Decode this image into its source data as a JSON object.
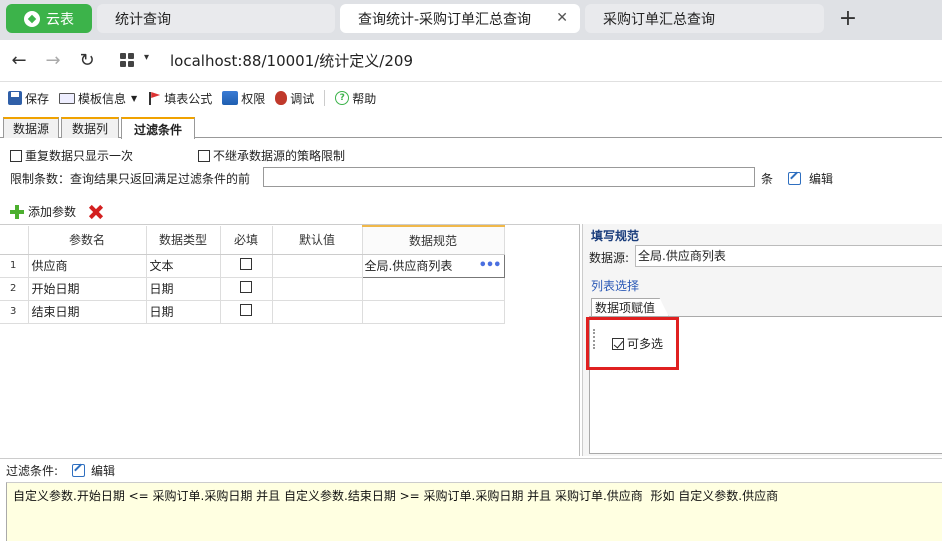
{
  "browser": {
    "brand": "云表",
    "tabs": [
      {
        "label": "统计查询"
      },
      {
        "label": "查询统计-采购订单汇总查询"
      },
      {
        "label": "采购订单汇总查询"
      }
    ],
    "close_glyph": "✕",
    "new_tab_glyph": "+",
    "url": "localhost:88/10001/统计定义/209"
  },
  "toolbar": {
    "save": "保存",
    "template": "模板信息",
    "formula": "填表公式",
    "permission": "权限",
    "debug": "调试",
    "help": "帮助"
  },
  "inner_tabs": [
    {
      "label": "数据源"
    },
    {
      "label": "数据列"
    },
    {
      "label": "过滤条件"
    }
  ],
  "options": {
    "show_once": "重复数据只显示一次",
    "no_inherit": "不继承数据源的策略限制",
    "limit_label": "限制条数：查询结果只返回满足过滤条件的前",
    "limit_value": "",
    "limit_unit": "条",
    "edit": "编辑"
  },
  "params": {
    "add_label": "添加参数",
    "columns": [
      "参数名",
      "数据类型",
      "必填",
      "默认值",
      "数据规范"
    ],
    "rows": [
      {
        "num": "1",
        "name": "供应商",
        "type": "文本",
        "required": false,
        "default": "",
        "spec": "全局.供应商列表"
      },
      {
        "num": "2",
        "name": "开始日期",
        "type": "日期",
        "required": false,
        "default": "",
        "spec": ""
      },
      {
        "num": "3",
        "name": "结束日期",
        "type": "日期",
        "required": false,
        "default": "",
        "spec": ""
      }
    ]
  },
  "right_panel": {
    "title": "填写规范",
    "source_label": "数据源:",
    "source_value": "全局.供应商列表",
    "list_select": "列表选择",
    "tab": "数据项赋值",
    "multi_select": "可多选"
  },
  "filter": {
    "label": "过滤条件:",
    "edit": "编辑",
    "text": "自定义参数.开始日期 <= 采购订单.采购日期 并且 自定义参数.结束日期 >= 采购订单.采购日期 并且 采购订单.供应商  形如 自定义参数.供应商"
  }
}
